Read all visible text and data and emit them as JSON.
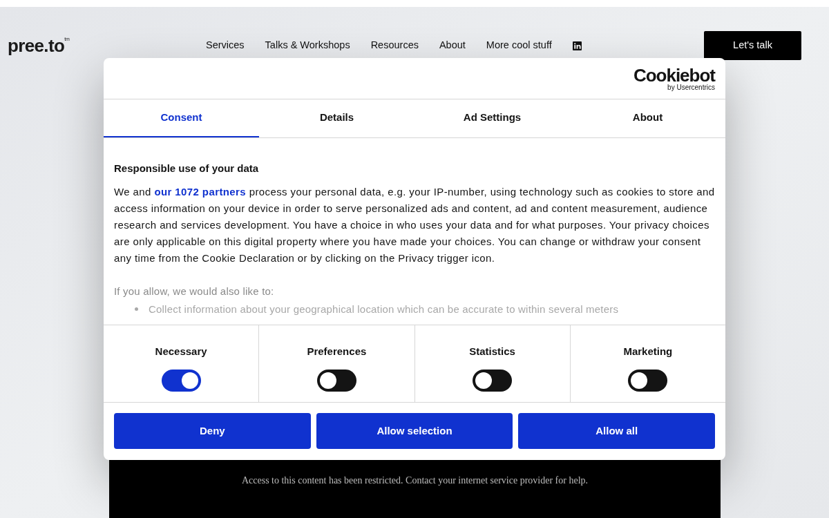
{
  "header": {
    "logo": "pree.to",
    "logo_mark": "tm",
    "nav": [
      "Services",
      "Talks & Workshops",
      "Resources",
      "About",
      "More cool stuff"
    ],
    "cta": "Let's talk"
  },
  "blocked_content": {
    "message": "Access to this content has been restricted. Contact your internet service provider for help."
  },
  "consent_dialog": {
    "brand": "Cookiebot",
    "brand_sub": "by Usercentrics",
    "tabs": [
      {
        "label": "Consent",
        "selected": true
      },
      {
        "label": "Details",
        "selected": false
      },
      {
        "label": "Ad Settings",
        "selected": false
      },
      {
        "label": "About",
        "selected": false
      }
    ],
    "heading": "Responsible use of your data",
    "body_before_link": "We and",
    "link": "our 1072 partners",
    "body_after_link": "process your personal data, e.g. your IP-number, using technology such as cookies to store and access information on your device in order to serve personalized ads and content, ad and content measurement, audience research and services development. You have a choice in who uses your data and for what purposes. Your privacy choices are only applicable on this digital property where you have made your choices. You can change or withdraw your consent any time from the Cookie Declaration or by clicking on the Privacy trigger icon.",
    "also_like": "If you allow, we would also like to:",
    "purposes": [
      "Collect information about your geographical location which can be accurate to within several meters"
    ],
    "toggles": [
      {
        "label": "Necessary",
        "on": true
      },
      {
        "label": "Preferences",
        "on": false
      },
      {
        "label": "Statistics",
        "on": false
      },
      {
        "label": "Marketing",
        "on": false
      }
    ],
    "buttons": [
      "Deny",
      "Allow selection",
      "Allow all"
    ]
  }
}
